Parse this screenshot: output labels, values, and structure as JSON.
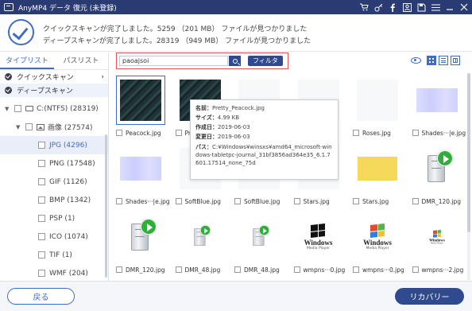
{
  "window": {
    "title": "AnyMP4 データ 復元 (未登録)",
    "icons": [
      "cart-icon",
      "key-icon",
      "facebook-icon",
      "user-icon",
      "save-icon",
      "menu-icon",
      "minimize-icon",
      "close-icon"
    ]
  },
  "header": {
    "status_quick": "クイックスキャンが完了しました。5259 （201 MB） ファイルが見つかりました",
    "status_deep": "ディープスキャンが完了しました。28319 （949 MB） ファイルが見つかりました"
  },
  "sidebar": {
    "tabs": [
      {
        "label": "タイプリスト",
        "active": true
      },
      {
        "label": "パスリスト",
        "active": false
      }
    ],
    "scans": [
      {
        "label": "クイックスキャン"
      },
      {
        "label": "ディープスキャン"
      }
    ],
    "tree": [
      {
        "label": "C:(NTFS) (28319)"
      },
      {
        "label": "画像 (27574)"
      },
      {
        "label": "JPG (4296)",
        "selected": true
      },
      {
        "label": "PNG (17548)"
      },
      {
        "label": "GIF (1126)"
      },
      {
        "label": "BMP (1342)"
      },
      {
        "label": "PSP (1)"
      },
      {
        "label": "ICO (1074)"
      },
      {
        "label": "TIF (1)"
      },
      {
        "label": "WMF (204)"
      }
    ]
  },
  "toolbar": {
    "search_value": "paoajsoi",
    "filter_label": "フィルタ"
  },
  "files": [
    {
      "name": "Peacock.jpg",
      "kind": "peacock",
      "selected": true
    },
    {
      "name": "Pr",
      "kind": "peacock"
    },
    {
      "name": "",
      "kind": "blank"
    },
    {
      "name": "",
      "kind": "blank"
    },
    {
      "name": "Roses.jpg",
      "kind": "blank"
    },
    {
      "name": "Shades···|e.jpg",
      "kind": "purple"
    },
    {
      "name": "Shades···|e.jpg",
      "kind": "purple"
    },
    {
      "name": "SoftBlue.jpg",
      "kind": "blank"
    },
    {
      "name": "SoftBlue.jpg",
      "kind": "blank"
    },
    {
      "name": "Stars.jpg",
      "kind": "blank"
    },
    {
      "name": "Stars.jpg",
      "kind": "yellow"
    },
    {
      "name": "DMR_120.jpg",
      "kind": "server"
    },
    {
      "name": "DMR_120.jpg",
      "kind": "server"
    },
    {
      "name": "DMR_48.jpg",
      "kind": "server-small"
    },
    {
      "name": "DMR_48.jpg",
      "kind": "server-small"
    },
    {
      "name": "wmpns···0.jpg",
      "kind": "wmp-mono"
    },
    {
      "name": "wmpns···0.jpg",
      "kind": "wmp-color"
    },
    {
      "name": "wmpns···2.jpg",
      "kind": "wmp-tiny"
    }
  ],
  "tooltip": {
    "name_label": "名前：",
    "name": "Pretty_Peacock.jpg",
    "size_label": "サイズ：",
    "size": "4.99 KB",
    "created_label": "作成日：",
    "created": "2019-06-03",
    "modified_label": "変更日：",
    "modified": "2019-06-03",
    "path_label": "パス：",
    "path": "C:¥Windows¥winsxs¥amd64_microsoft-windows-tabletpc-journal_31bf3856ad364e35_6.1.7601.17514_none_75d"
  },
  "wmp_text": {
    "windows": "Windows",
    "player": "Media Player"
  },
  "footer": {
    "back_label": "戻る",
    "recover_label": "リカバリー"
  },
  "colors": {
    "titlebar": "#2a3b73",
    "accent": "#3f6cc8",
    "primary_button": "#2f4a8f",
    "highlight_border": "#e05555"
  }
}
